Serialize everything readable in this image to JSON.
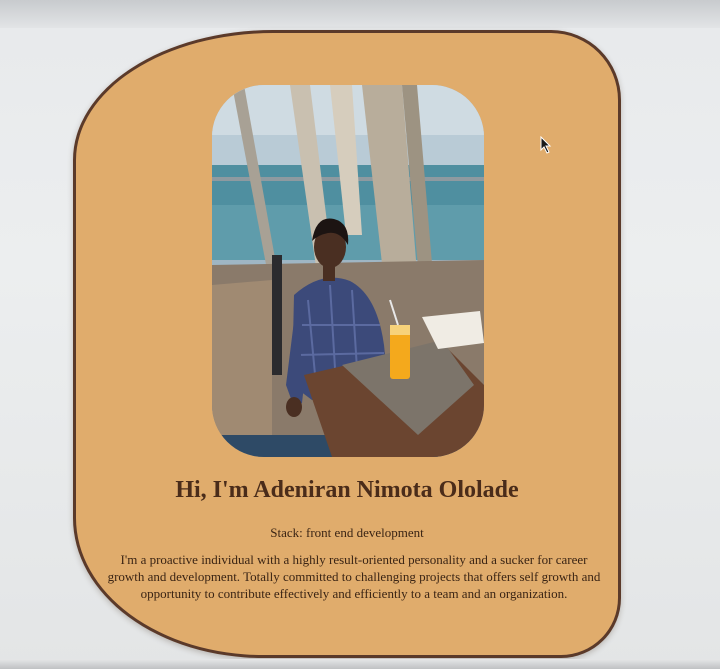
{
  "profile": {
    "greeting": "Hi, I'm Adeniran Nimota Ololade",
    "stack": "Stack: front end development",
    "bio": "I'm a proactive individual with a highly result-oriented personality and a sucker for career growth and development. Totally committed to challenging projects that offers self growth and opportunity to contribute effectively and efficiently to a team and an organization."
  },
  "colors": {
    "card_background": "#e0ac6c",
    "card_border": "#5b3a2a",
    "heading_text": "#4a2c1a",
    "body_text": "#3a2414"
  },
  "icons": {
    "cursor": "mouse-pointer-icon"
  }
}
